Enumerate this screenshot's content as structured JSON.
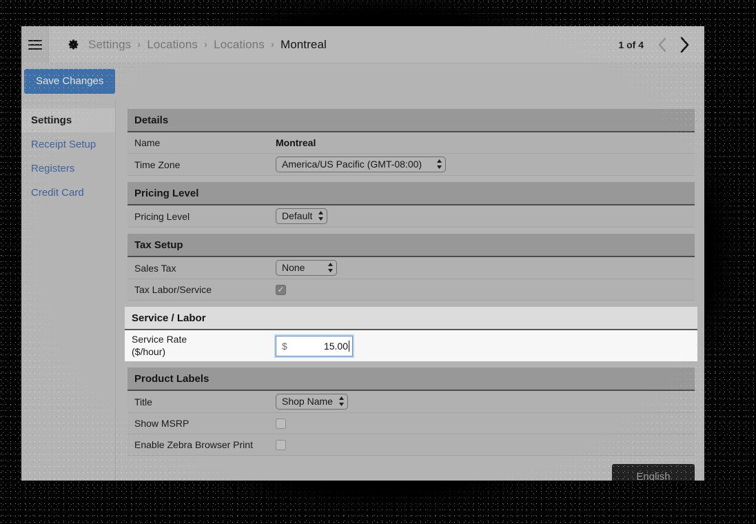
{
  "topbar": {
    "menu_icon": "hamburger-menu-icon",
    "gear_icon": "gear-icon",
    "breadcrumb": [
      {
        "label": "Settings",
        "current": false
      },
      {
        "label": "Locations",
        "current": false
      },
      {
        "label": "Locations",
        "current": false
      },
      {
        "label": "Montreal",
        "current": true
      }
    ],
    "separator": "›",
    "pager": {
      "count_label": "1 of 4",
      "prev_icon": "chevron-left-icon",
      "next_icon": "chevron-right-icon",
      "prev_enabled": false,
      "next_enabled": true
    }
  },
  "toolbar": {
    "save_label": "Save Changes"
  },
  "sidebar": {
    "items": [
      {
        "label": "Settings",
        "active": true
      },
      {
        "label": "Receipt Setup",
        "active": false
      },
      {
        "label": "Registers",
        "active": false
      },
      {
        "label": "Credit Card",
        "active": false
      }
    ]
  },
  "sections": {
    "details": {
      "title": "Details",
      "name_label": "Name",
      "name_value": "Montreal",
      "timezone_label": "Time Zone",
      "timezone_value": "America/US Pacific (GMT-08:00)"
    },
    "pricing": {
      "title": "Pricing Level",
      "level_label": "Pricing Level",
      "level_value": "Default"
    },
    "tax": {
      "title": "Tax Setup",
      "sales_tax_label": "Sales Tax",
      "sales_tax_value": "None",
      "tax_labor_label": "Tax Labor/Service",
      "tax_labor_checked": true
    },
    "service": {
      "title": "Service / Labor",
      "rate_label_line1": "Service Rate",
      "rate_label_line2": "($/hour)",
      "currency_symbol": "$",
      "rate_value": "15.00"
    },
    "product_labels": {
      "title": "Product Labels",
      "title_label": "Title",
      "title_value": "Shop Name",
      "show_msrp_label": "Show MSRP",
      "show_msrp_checked": false,
      "zebra_label": "Enable Zebra Browser Print",
      "zebra_checked": false
    }
  },
  "overlay": {
    "language_chip": "English"
  },
  "colors": {
    "accent_button": "#3d6fa8",
    "link": "#3c6299",
    "focus_border": "#5b8fd4",
    "chrome_bg": "#b4b4b4",
    "section_header": "#989898",
    "focused_section_header": "#dcdcdc"
  }
}
